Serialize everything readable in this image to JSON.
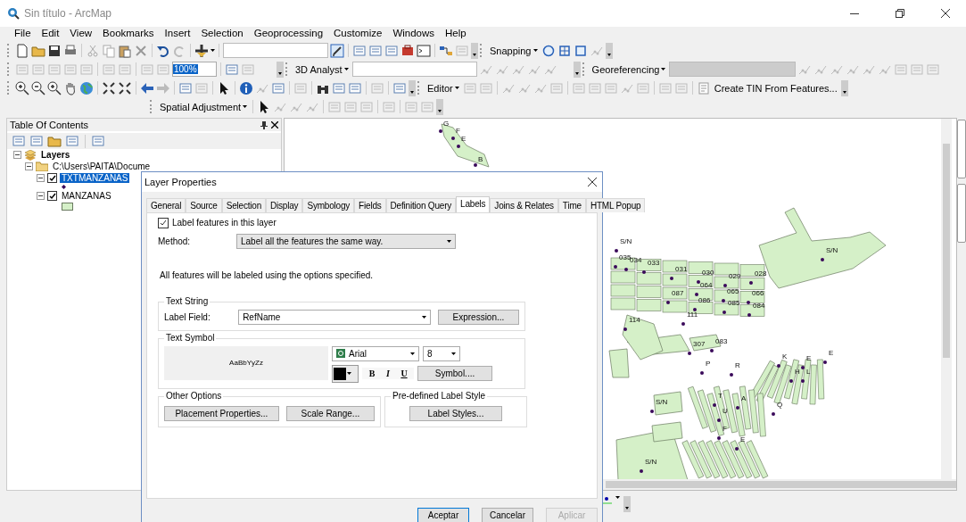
{
  "window": {
    "title": "Sin título - ArcMap"
  },
  "menu": [
    {
      "label": "File"
    },
    {
      "label": "Edit"
    },
    {
      "label": "View"
    },
    {
      "label": "Bookmarks"
    },
    {
      "label": "Insert"
    },
    {
      "label": "Selection"
    },
    {
      "label": "Geoprocessing"
    },
    {
      "label": "Customize"
    },
    {
      "label": "Windows"
    },
    {
      "label": "Help"
    }
  ],
  "toolbars": {
    "snapping": "Snapping",
    "zoom_value": "100%",
    "analyst": "3D Analyst",
    "georeferencing": "Georeferencing",
    "editor": "Editor",
    "tin": "Create TIN From Features...",
    "spatial": "Spatial Adjustment"
  },
  "toc": {
    "title": "Table Of Contents",
    "tree": [
      {
        "label": "Layers",
        "kind": "layers",
        "expanded": true,
        "children": [
          {
            "label": "C:\\Users\\PAITA\\Docume",
            "kind": "folder",
            "expanded": true,
            "children": [
              {
                "label": "TXTMANZANAS",
                "kind": "point",
                "expanded": true,
                "checked": true,
                "selected": true
              },
              {
                "label": "MANZANAS",
                "kind": "polygon",
                "expanded": true,
                "checked": true,
                "selected": false
              }
            ]
          }
        ]
      }
    ]
  },
  "map": {
    "labels": [
      {
        "text": "S/N"
      },
      {
        "text": "035"
      },
      {
        "text": "034"
      },
      {
        "text": "033"
      },
      {
        "text": "031"
      },
      {
        "text": "030"
      },
      {
        "text": "029"
      },
      {
        "text": "028"
      },
      {
        "text": "064"
      },
      {
        "text": "065"
      },
      {
        "text": "066"
      },
      {
        "text": "085"
      },
      {
        "text": "084"
      },
      {
        "text": "086"
      },
      {
        "text": "087"
      },
      {
        "text": "111"
      },
      {
        "text": "114"
      },
      {
        "text": "307"
      },
      {
        "text": "083"
      },
      {
        "text": "K"
      },
      {
        "text": "E"
      },
      {
        "text": "E"
      },
      {
        "text": "P"
      },
      {
        "text": "R"
      },
      {
        "text": "T"
      },
      {
        "text": "U"
      },
      {
        "text": "S/N"
      },
      {
        "text": "S/N"
      },
      {
        "text": "S/N"
      },
      {
        "text": "A"
      },
      {
        "text": "Q"
      },
      {
        "text": "L"
      },
      {
        "text": "H"
      },
      {
        "text": "E"
      },
      {
        "text": "F"
      },
      {
        "text": "G"
      },
      {
        "text": "F"
      },
      {
        "text": "E"
      },
      {
        "text": "B"
      }
    ]
  },
  "dialog": {
    "title": "Layer Properties",
    "tabs": [
      {
        "label": "General",
        "selected": false
      },
      {
        "label": "Source",
        "selected": false
      },
      {
        "label": "Selection",
        "selected": false
      },
      {
        "label": "Display",
        "selected": false
      },
      {
        "label": "Symbology",
        "selected": false
      },
      {
        "label": "Fields",
        "selected": false
      },
      {
        "label": "Definition Query",
        "selected": false
      },
      {
        "label": "Labels",
        "selected": true
      },
      {
        "label": "Joins & Relates",
        "selected": false
      },
      {
        "label": "Time",
        "selected": false
      },
      {
        "label": "HTML Popup",
        "selected": false
      }
    ],
    "label_features": {
      "label": "Label features in this layer",
      "checked": true
    },
    "method": {
      "label": "Method:",
      "value": "Label all the features the same way."
    },
    "info": "All features will be labeled using the options specified.",
    "text_string": {
      "title": "Text String",
      "field_label": "Label Field:",
      "field_value": "RefName",
      "button": "Expression..."
    },
    "text_symbol": {
      "title": "Text Symbol",
      "preview": "AaBbYyZz",
      "font": "Arial",
      "size": "8",
      "bold": "B",
      "italic": "I",
      "underline": "U",
      "button": "Symbol...."
    },
    "other_options": {
      "title": "Other Options",
      "buttons": [
        "Placement Properties...",
        "Scale Range..."
      ]
    },
    "predefined": {
      "title": "Pre-defined Label Style",
      "button": "Label Styles..."
    },
    "buttons": [
      {
        "label": "Aceptar",
        "default": true,
        "disabled": false
      },
      {
        "label": "Cancelar",
        "default": false,
        "disabled": false
      },
      {
        "label": "Aplicar",
        "default": false,
        "disabled": true
      }
    ]
  }
}
